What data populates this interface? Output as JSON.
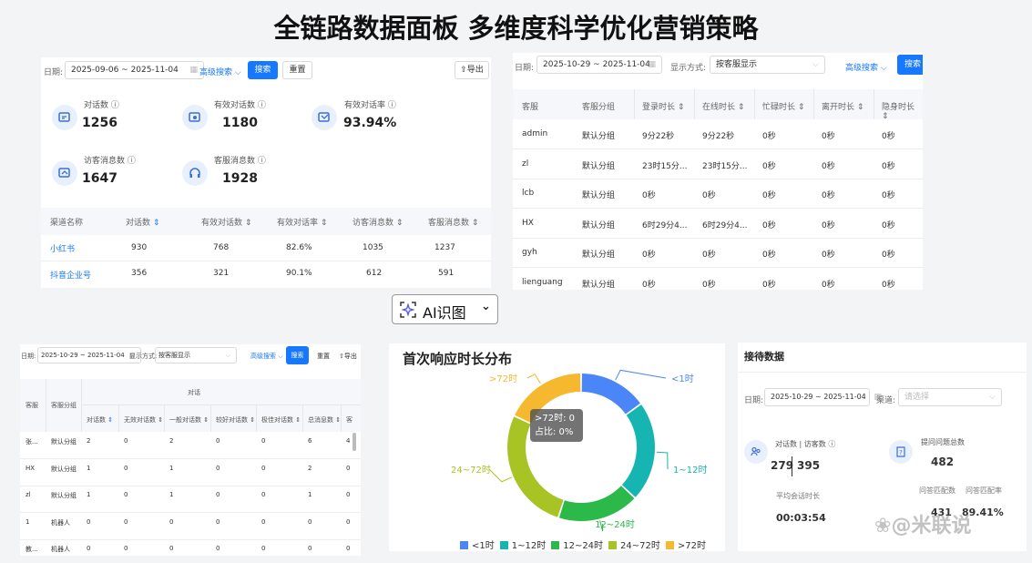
{
  "page_title": "全链路数据面板 多维度科学优化营销策略",
  "ai_button": {
    "label": "AI识图",
    "arrow": "⌄"
  },
  "watermark": "@米联说",
  "panel_a": {
    "date_label": "日期:",
    "date_range": "2025-09-06 ~ 2025-11-04",
    "adv_search": "高级搜索",
    "search": "搜索",
    "reset": "重置",
    "export": "导出",
    "stats": [
      {
        "label": "对话数",
        "value": "1256",
        "icon": "chat-icon"
      },
      {
        "label": "有效对话数",
        "value": "1180",
        "icon": "chat-check-icon"
      },
      {
        "label": "有效对话率",
        "value": "93.94%",
        "icon": "rate-icon"
      },
      {
        "label": "访客消息数",
        "value": "1647",
        "icon": "visitor-msg-icon"
      },
      {
        "label": "客服消息数",
        "value": "1928",
        "icon": "agent-headset-icon"
      }
    ],
    "columns": [
      "渠道名称",
      "对话数",
      "有效对话数",
      "有效对话率",
      "访客消息数",
      "客服消息数"
    ],
    "rows": [
      [
        "小红书",
        "930",
        "768",
        "82.6%",
        "1035",
        "1237"
      ],
      [
        "抖音企业号",
        "356",
        "321",
        "90.1%",
        "612",
        "591"
      ]
    ]
  },
  "panel_b": {
    "date_label": "日期:",
    "date_range": "2025-10-29 ~ 2025-11-04",
    "mode_label": "显示方式:",
    "mode_value": "按客服显示",
    "adv_search": "高级搜索",
    "search": "搜索",
    "columns": [
      "客服",
      "客服分组",
      "登录时长",
      "在线时长",
      "忙碌时长",
      "离开时长",
      "隐身时长"
    ],
    "rows": [
      [
        "admin",
        "默认分组",
        "9分22秒",
        "9分22秒",
        "0秒",
        "0秒",
        "0秒"
      ],
      [
        "zl",
        "默认分组",
        "23时15分...",
        "23时15分...",
        "0秒",
        "0秒",
        "0秒"
      ],
      [
        "lcb",
        "默认分组",
        "0秒",
        "0秒",
        "0秒",
        "0秒",
        "0秒"
      ],
      [
        "HX",
        "默认分组",
        "6时29分4...",
        "6时29分4...",
        "0秒",
        "0秒",
        "0秒"
      ],
      [
        "gyh",
        "默认分组",
        "0秒",
        "0秒",
        "0秒",
        "0秒",
        "0秒"
      ],
      [
        "lienguang",
        "默认分组",
        "0秒",
        "0秒",
        "0秒",
        "0秒",
        "0秒"
      ]
    ]
  },
  "panel_c": {
    "date_label": "日期:",
    "date_range": "2025-10-29 ~ 2025-11-04",
    "mode_label": "显示方式:",
    "mode_value": "按客服显示",
    "adv_search": "高级搜索",
    "search": "搜索",
    "reset": "重置",
    "export": "导出",
    "group_header": "对话",
    "col_agent": "客服",
    "col_group": "客服分组",
    "columns": [
      "对话数",
      "无效对话数",
      "一般对话数",
      "较好对话数",
      "极佳对话数",
      "总消息数",
      "客"
    ],
    "rows": [
      [
        "张...",
        "默认分组",
        "2",
        "0",
        "2",
        "0",
        "0",
        "6",
        "4"
      ],
      [
        "HX",
        "默认分组",
        "1",
        "0",
        "1",
        "0",
        "0",
        "2",
        "0"
      ],
      [
        "zl",
        "默认分组",
        "1",
        "0",
        "1",
        "0",
        "0",
        "1",
        "0"
      ],
      [
        "1",
        "机器人",
        "0",
        "0",
        "0",
        "0",
        "0",
        "0",
        "0"
      ],
      [
        "教...",
        "机器人",
        "0",
        "0",
        "0",
        "0",
        "0",
        "0",
        "0"
      ]
    ]
  },
  "panel_d": {
    "tooltip_title": ">72时: 0",
    "tooltip_ratio": "占比: 0%",
    "chart_data": {
      "type": "pie",
      "title": "首次响应时长分布",
      "categories": [
        "<1时",
        "1~12时",
        "12~24时",
        "24~72时",
        ">72时"
      ],
      "values": [
        15,
        22,
        18,
        27,
        18
      ],
      "colors": [
        "#4a86f7",
        "#16b5b1",
        "#2bba4a",
        "#a7c424",
        "#f5b82e"
      ],
      "legend": "bottom"
    }
  },
  "panel_e": {
    "title": "接待数据",
    "date_label": "日期:",
    "date_range": "2025-10-29 ~ 2025-11-04",
    "channel_label": "渠道:",
    "channel_placeholder": "请选择",
    "conv_label": "对话数 | 访客数",
    "conv_value": "279",
    "visitor_value": "395",
    "q_label": "提问问题总数",
    "q_value": "482",
    "avg_label": "平均会话时长",
    "avg_value": "00:03:54",
    "answered_label": "问答匹配数",
    "answered_value": "431",
    "rate_label": "问答匹配率",
    "rate_value": "89.41%"
  }
}
